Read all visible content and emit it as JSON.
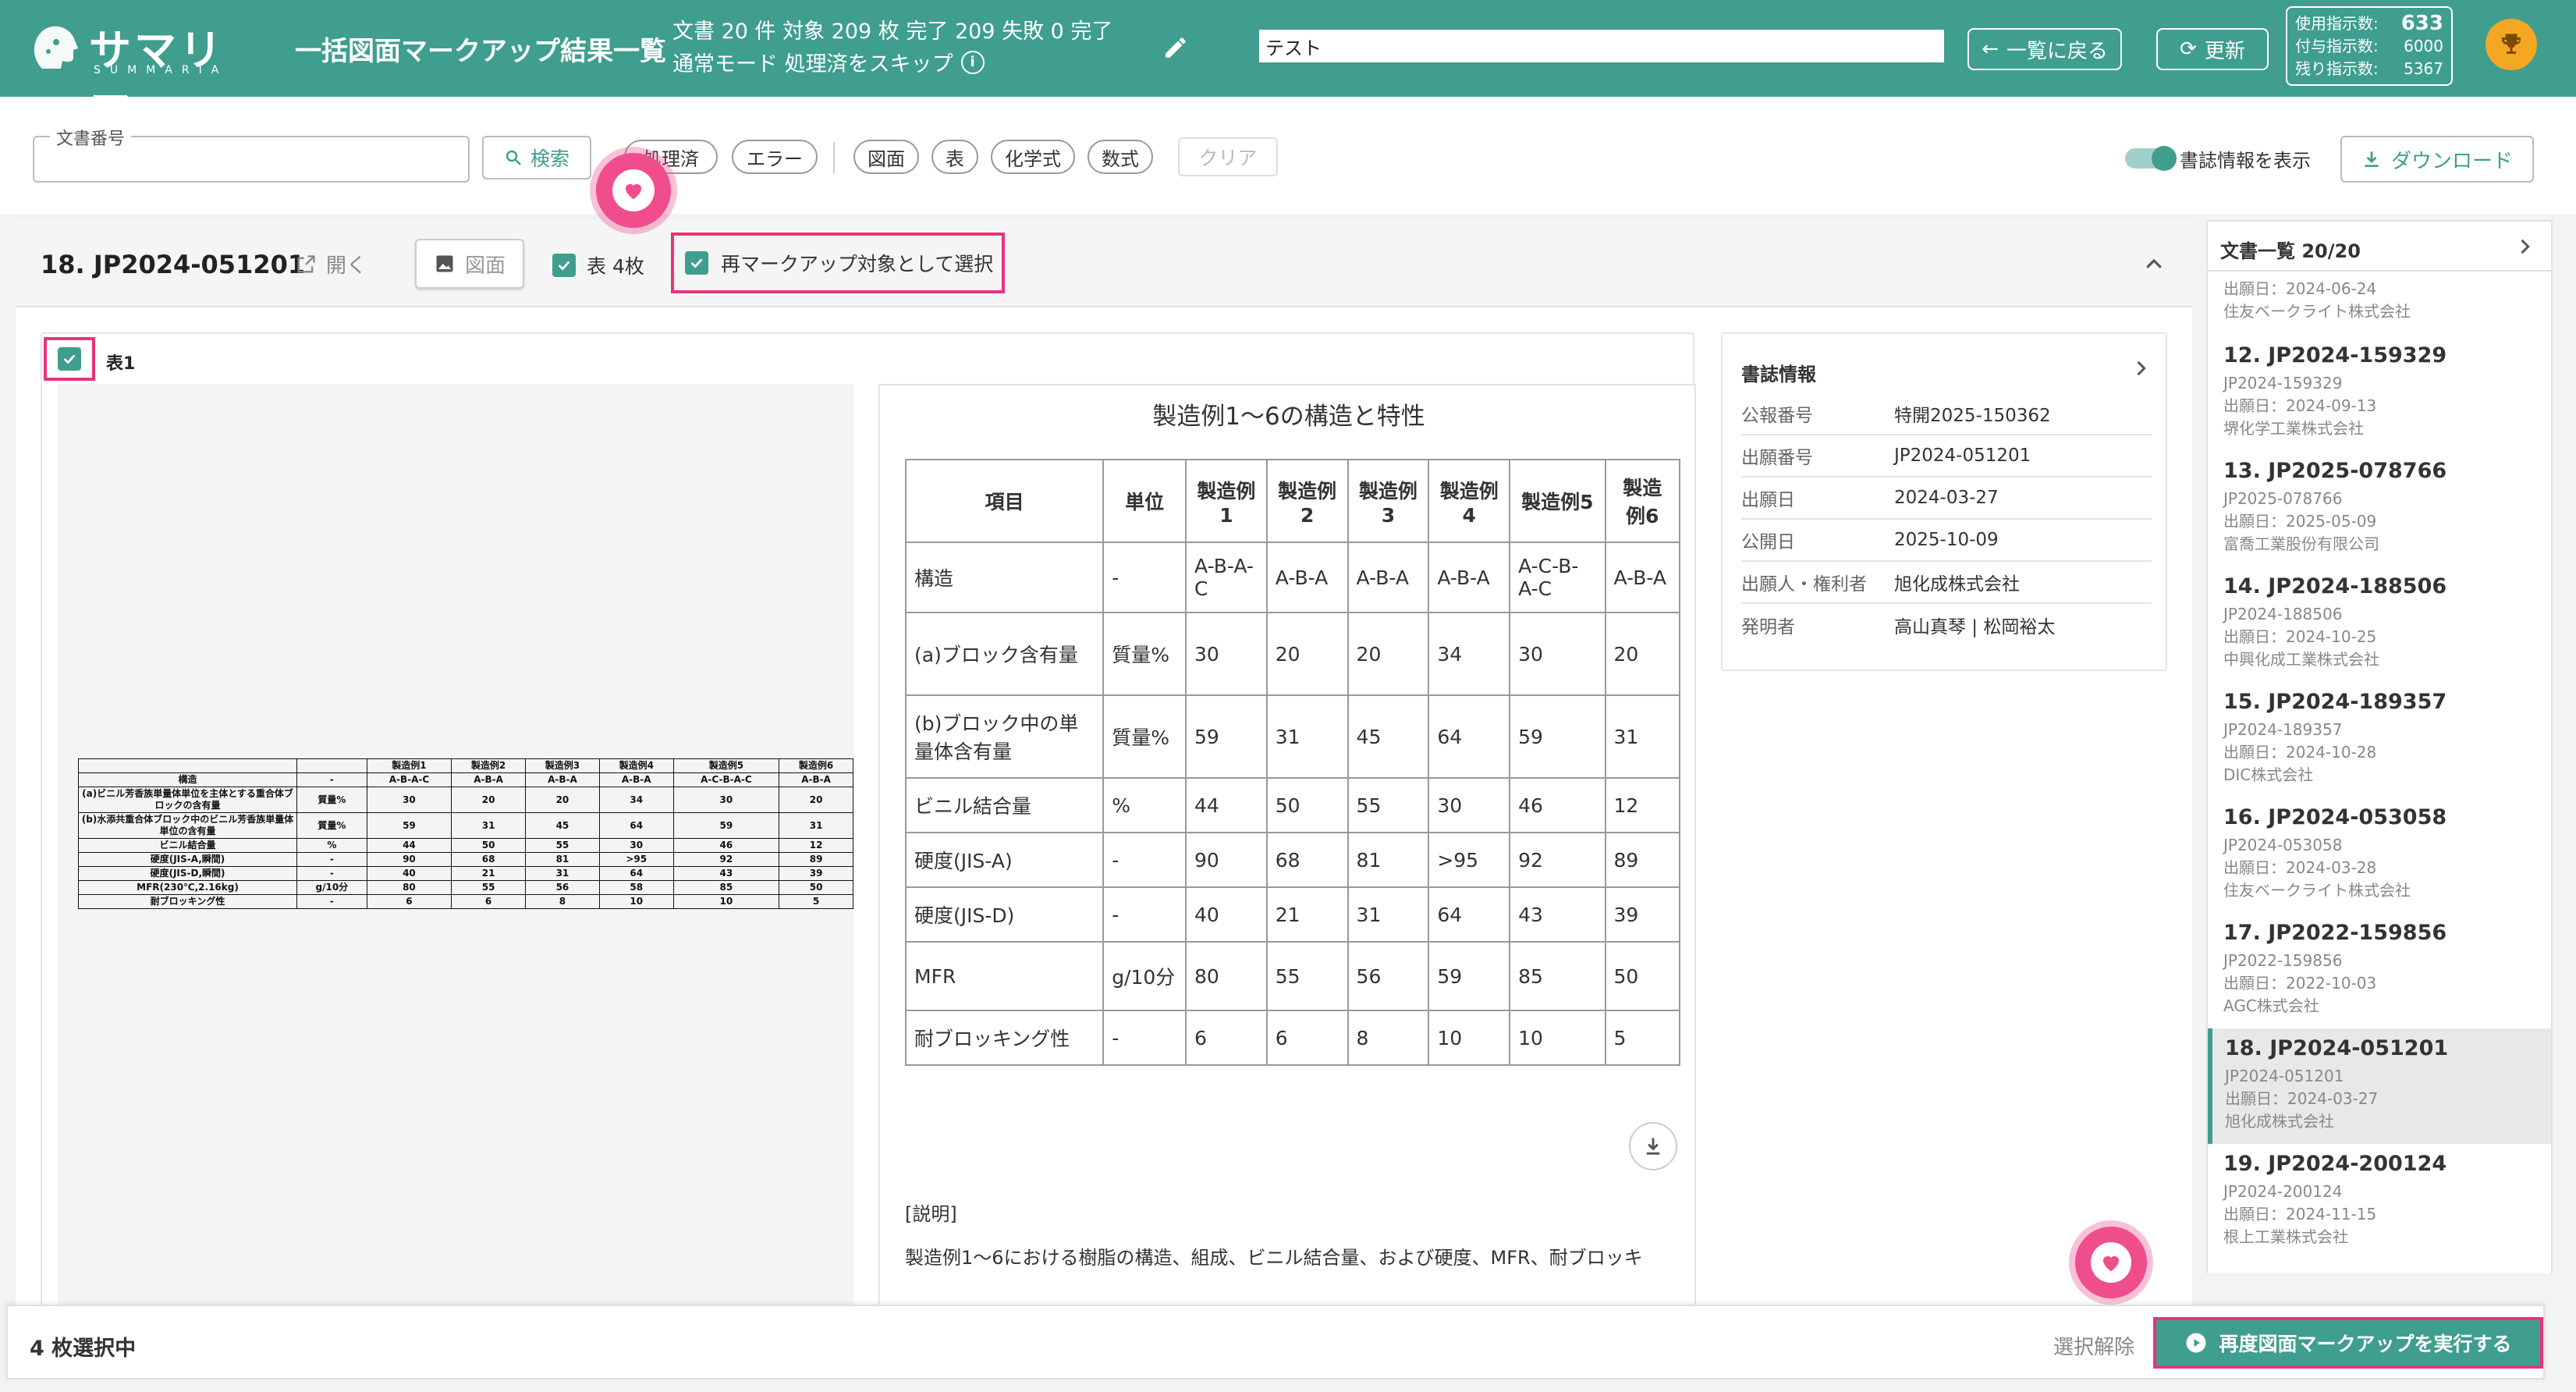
{
  "header": {
    "logo_text": "サマリア",
    "logo_sub": "SUMMARIA",
    "page_title": "一括図面マークアップ結果一覧",
    "stats_line1": "文書 20 件 対象 209 枚 完了 209 失敗 0 完了",
    "stats_line2": "通常モード 処理済をスキップ",
    "name_value": "テスト",
    "back_label": "一覧に戻る",
    "refresh_label": "更新",
    "usage_label1": "使用指示数:",
    "usage_value1": "633",
    "usage_label2": "付与指示数:",
    "usage_value2": "6000",
    "usage_label3": "残り指示数:",
    "usage_value3": "5367",
    "accent": "#3f9e8e"
  },
  "filters": {
    "doc_number_label": "文書番号",
    "doc_number_value": "",
    "search_label": "検索",
    "chips": [
      "処理済",
      "エラー"
    ],
    "type_chips": [
      "図面",
      "表",
      "化学式",
      "数式"
    ],
    "clear_label": "クリア",
    "biblio_toggle_label": "書誌情報を表示",
    "download_label": "ダウンロード"
  },
  "document": {
    "title": "18. JP2024-051201",
    "open_label": "開く",
    "figure_label": "図面",
    "table_count_label": "表 4枚",
    "remarkup_label": "再マークアップ対象として選択",
    "table_checkbox_label": "表1"
  },
  "result": {
    "table_title": "製造例1〜6の構造と特性",
    "headers": [
      "項目",
      "単位",
      "製造例1",
      "製造例2",
      "製造例3",
      "製造例4",
      "製造例5",
      "製造例6"
    ],
    "rows": [
      [
        "構造",
        "-",
        "A-B-A-C",
        "A-B-A",
        "A-B-A",
        "A-B-A",
        "A-C-B-A-C",
        "A-B-A"
      ],
      [
        "(a)ブロック含有量",
        "質量%",
        "30",
        "20",
        "20",
        "34",
        "30",
        "20"
      ],
      [
        "(b)ブロック中の単量体含有量",
        "質量%",
        "59",
        "31",
        "45",
        "64",
        "59",
        "31"
      ],
      [
        "ビニル結合量",
        "%",
        "44",
        "50",
        "55",
        "30",
        "46",
        "12"
      ],
      [
        "硬度(JIS-A)",
        "-",
        "90",
        "68",
        "81",
        ">95",
        "92",
        "89"
      ],
      [
        "硬度(JIS-D)",
        "-",
        "40",
        "21",
        "31",
        "64",
        "43",
        "39"
      ],
      [
        "MFR",
        "g/10分",
        "80",
        "55",
        "56",
        "59",
        "85",
        "50"
      ],
      [
        "耐ブロッキング性",
        "-",
        "6",
        "6",
        "8",
        "10",
        "10",
        "5"
      ]
    ],
    "explain_heading": "[説明]",
    "explain_text": "製造例1〜6における樹脂の構造、組成、ビニル結合量、および硬度、MFR、耐ブロッキ"
  },
  "source_image": {
    "headers": [
      "",
      "",
      "製造例1",
      "製造例2",
      "製造例3",
      "製造例4",
      "製造例5",
      "製造例6"
    ],
    "rows": [
      [
        "構造",
        "-",
        "A-B-A-C",
        "A-B-A",
        "A-B-A",
        "A-B-A",
        "A-C-B-A-C",
        "A-B-A"
      ],
      [
        "(a)ビニル芳香族単量体単位を主体とする重合体ブロックの含有量",
        "質量%",
        "30",
        "20",
        "20",
        "34",
        "30",
        "20"
      ],
      [
        "(b)水添共重合体ブロック中のビニル芳香族単量体単位の含有量",
        "質量%",
        "59",
        "31",
        "45",
        "64",
        "59",
        "31"
      ],
      [
        "ビニル結合量",
        "%",
        "44",
        "50",
        "55",
        "30",
        "46",
        "12"
      ],
      [
        "硬度(JIS-A,瞬間)",
        "-",
        "90",
        "68",
        "81",
        ">95",
        "92",
        "89"
      ],
      [
        "硬度(JIS-D,瞬間)",
        "-",
        "40",
        "21",
        "31",
        "64",
        "43",
        "39"
      ],
      [
        "MFR(230℃,2.16kg)",
        "g/10分",
        "80",
        "55",
        "56",
        "58",
        "85",
        "50"
      ],
      [
        "耐ブロッキング性",
        "-",
        "6",
        "6",
        "8",
        "10",
        "10",
        "5"
      ]
    ]
  },
  "biblio": {
    "title": "書誌情報",
    "rows": [
      {
        "k": "公報番号",
        "v": "特開2025-150362"
      },
      {
        "k": "出願番号",
        "v": "JP2024-051201"
      },
      {
        "k": "出願日",
        "v": "2024-03-27"
      },
      {
        "k": "公開日",
        "v": "2025-10-09"
      },
      {
        "k": "出願人・権利者",
        "v": "旭化成株式会社"
      },
      {
        "k": "発明者",
        "v": "高山真琴 | 松岡裕太"
      }
    ]
  },
  "doclist": {
    "title": "文書一覧 20/20",
    "partial": {
      "date": "出願日：2024-06-24",
      "company": "住友ベークライト株式会社"
    },
    "items": [
      {
        "t": "12. JP2024-159329",
        "n": "JP2024-159329",
        "d": "出願日：2024-09-13",
        "c": "堺化学工業株式会社"
      },
      {
        "t": "13. JP2025-078766",
        "n": "JP2025-078766",
        "d": "出願日：2025-05-09",
        "c": "富喬工業股份有限公司"
      },
      {
        "t": "14. JP2024-188506",
        "n": "JP2024-188506",
        "d": "出願日：2024-10-25",
        "c": "中興化成工業株式会社"
      },
      {
        "t": "15. JP2024-189357",
        "n": "JP2024-189357",
        "d": "出願日：2024-10-28",
        "c": "DIC株式会社"
      },
      {
        "t": "16. JP2024-053058",
        "n": "JP2024-053058",
        "d": "出願日：2024-03-28",
        "c": "住友ベークライト株式会社"
      },
      {
        "t": "17. JP2022-159856",
        "n": "JP2022-159856",
        "d": "出願日：2022-10-03",
        "c": "AGC株式会社"
      },
      {
        "t": "18. JP2024-051201",
        "n": "JP2024-051201",
        "d": "出願日：2024-03-27",
        "c": "旭化成株式会社"
      },
      {
        "t": "19. JP2024-200124",
        "n": "JP2024-200124",
        "d": "出願日：2024-11-15",
        "c": "根上工業株式会社"
      }
    ]
  },
  "footer": {
    "selected_label": "4 枚選択中",
    "clear_selection_label": "選択解除",
    "run_label": "再度図面マークアップを実行する"
  }
}
